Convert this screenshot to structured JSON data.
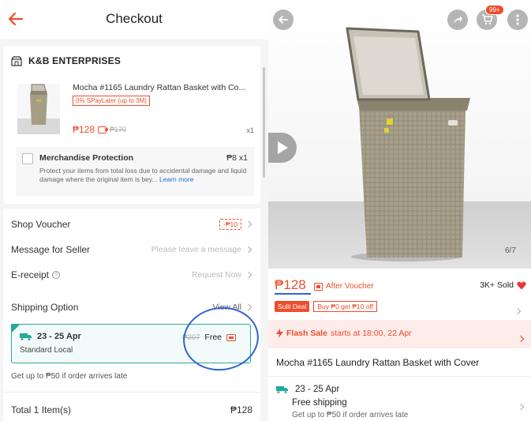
{
  "checkout": {
    "title": "Checkout",
    "shop_name": "K&B ENTERPRISES",
    "product": {
      "title": "Mocha #1165 Laundry Rattan Basket with Co...",
      "paylater_tag": "0% SPayLater (up to 3M)",
      "price": "₱128",
      "old_price": "₱170",
      "quantity": "x1"
    },
    "merch_protection": {
      "title": "Merchandise Protection",
      "price": "₱8 x1",
      "description": "Protect your items from total loss due to accidental damage and liquid damage where the original item is bey...",
      "link": "Learn more"
    },
    "shop_voucher": {
      "label": "Shop Voucher",
      "tag": "-₱10"
    },
    "message": {
      "label": "Message for Seller",
      "placeholder": "Please leave a message"
    },
    "ereceipt": {
      "label": "E-receipt",
      "value": "Request Now"
    },
    "shipping": {
      "label": "Shipping Option",
      "view_all": "View All",
      "date": "23 - 25 Apr",
      "type": "Standard Local",
      "old_price": "₱207",
      "price": "Free",
      "note": "Get up to ₱50 if order arrives late"
    },
    "total": {
      "label": "Total 1 Item(s)",
      "value": "₱128"
    }
  },
  "product_page": {
    "cart_badge": "99+",
    "image_counter": "6/7",
    "price": "₱128",
    "after_voucher": "After Voucher",
    "sold": "3K+ Sold",
    "deal_tag": "Sulit Deal",
    "buy_tag": "Buy ₱0 get ₱10 off",
    "flash_sale": {
      "label": "Flash Sale",
      "text": "starts at 18:00, 22 Apr"
    },
    "title": "Mocha #1165 Laundry Rattan Basket with Cover",
    "shipping": {
      "date": "23 - 25 Apr",
      "free": "Free shipping",
      "note": "Get up to ₱50 if order arrives late"
    }
  },
  "icons": [
    "back-arrow-icon",
    "shop-icon",
    "coin-icon",
    "info-icon",
    "truck-icon",
    "share-icon",
    "cart-icon",
    "more-icon",
    "play-icon",
    "heart-icon",
    "flash-icon",
    "chevron-right-icon"
  ],
  "colors": {
    "accent": "#ee4d2d",
    "teal": "#26aa99",
    "annotation_blue": "#2e63d6"
  }
}
